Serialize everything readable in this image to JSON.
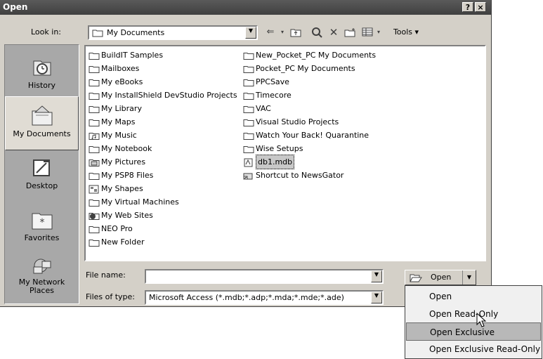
{
  "window": {
    "title": "Open",
    "help_btn": "?",
    "close_btn": "×"
  },
  "toolbar": {
    "look_in_label": "Look in:",
    "look_in_value": "My Documents",
    "tools_label": "Tools ▾"
  },
  "places": [
    {
      "label": "History",
      "icon": "history-icon"
    },
    {
      "label": "My Documents",
      "icon": "my-documents-icon"
    },
    {
      "label": "Desktop",
      "icon": "desktop-icon"
    },
    {
      "label": "Favorites",
      "icon": "favorites-icon"
    },
    {
      "label": "My Network Places",
      "icon": "network-places-icon"
    }
  ],
  "files": {
    "col1": [
      {
        "name": "BuildIT Samples",
        "icon": "folder-icon"
      },
      {
        "name": "Mailboxes",
        "icon": "folder-icon"
      },
      {
        "name": "My eBooks",
        "icon": "folder-icon"
      },
      {
        "name": "My InstallShield DevStudio Projects",
        "icon": "folder-icon"
      },
      {
        "name": "My Library",
        "icon": "folder-icon"
      },
      {
        "name": "My Maps",
        "icon": "folder-icon"
      },
      {
        "name": "My Music",
        "icon": "music-folder-icon"
      },
      {
        "name": "My Notebook",
        "icon": "folder-icon"
      },
      {
        "name": "My Pictures",
        "icon": "pictures-folder-icon"
      },
      {
        "name": "My PSP8 Files",
        "icon": "folder-icon"
      },
      {
        "name": "My Shapes",
        "icon": "shapes-folder-icon"
      },
      {
        "name": "My Virtual Machines",
        "icon": "folder-icon"
      },
      {
        "name": "My Web Sites",
        "icon": "web-folder-icon"
      },
      {
        "name": "NEO Pro",
        "icon": "folder-icon"
      },
      {
        "name": "New Folder",
        "icon": "folder-icon"
      }
    ],
    "col2": [
      {
        "name": "New_Pocket_PC My Documents",
        "icon": "folder-icon"
      },
      {
        "name": "Pocket_PC My Documents",
        "icon": "folder-icon"
      },
      {
        "name": "PPCSave",
        "icon": "folder-icon"
      },
      {
        "name": "Timecore",
        "icon": "folder-icon"
      },
      {
        "name": "VAC",
        "icon": "folder-icon"
      },
      {
        "name": "Visual Studio Projects",
        "icon": "folder-icon"
      },
      {
        "name": "Watch Your Back! Quarantine",
        "icon": "folder-icon"
      },
      {
        "name": "Wise Setups",
        "icon": "folder-icon"
      },
      {
        "name": "db1.mdb",
        "icon": "access-file-icon",
        "selected": true
      },
      {
        "name": "Shortcut to NewsGator",
        "icon": "shortcut-icon"
      }
    ]
  },
  "file_name": {
    "label": "File name:",
    "value": ""
  },
  "file_type": {
    "label": "Files of type:",
    "value": "Microsoft Access (*.mdb;*.adp;*.mda;*.mde;*.ade)"
  },
  "open_button": {
    "label": "Open"
  },
  "open_menu": [
    {
      "label": "Open"
    },
    {
      "label": "Open Read-Only"
    },
    {
      "label": "Open Exclusive",
      "highlighted": true
    },
    {
      "label": "Open Exclusive Read-Only"
    }
  ]
}
